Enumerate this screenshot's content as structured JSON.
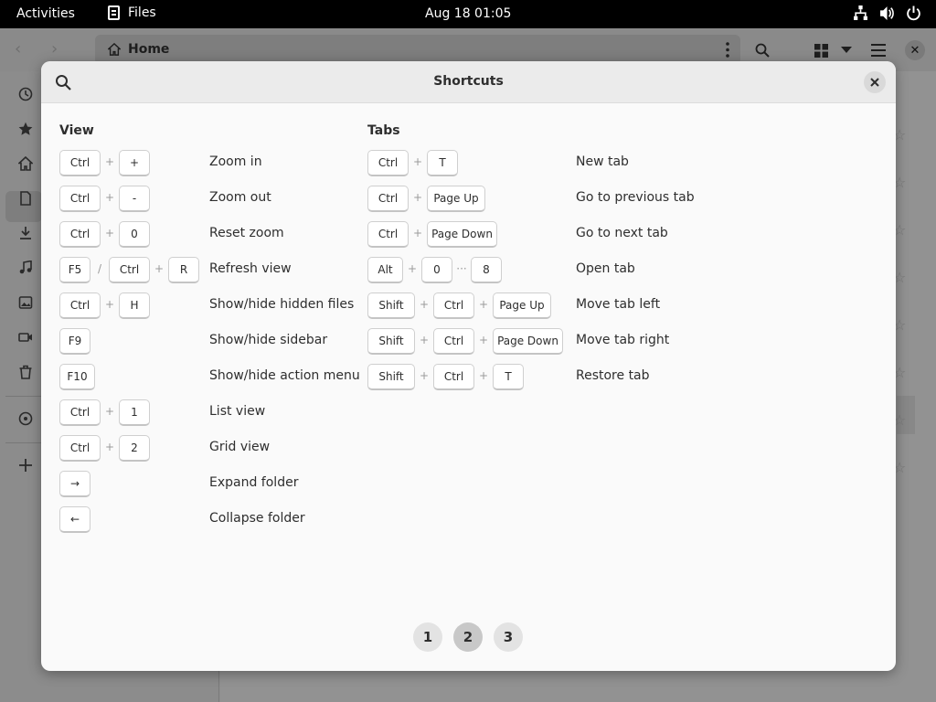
{
  "topbar": {
    "activities": "Activities",
    "app_name": "Files",
    "clock": "Aug 18  01:05"
  },
  "files": {
    "path_label": "Home"
  },
  "dialog": {
    "title": "Shortcuts",
    "sections": [
      {
        "title": "View",
        "rows": [
          {
            "keys": [
              "Ctrl",
              "+",
              "+"
            ],
            "desc": "Zoom in"
          },
          {
            "keys": [
              "Ctrl",
              "+",
              "-"
            ],
            "desc": "Zoom out"
          },
          {
            "keys": [
              "Ctrl",
              "+",
              "0"
            ],
            "desc": "Reset zoom"
          },
          {
            "keys": [
              "F5",
              "/",
              "Ctrl",
              "+",
              "R"
            ],
            "desc": "Refresh view"
          },
          {
            "keys": [
              "Ctrl",
              "+",
              "H"
            ],
            "desc": "Show/hide hidden files"
          },
          {
            "keys": [
              "F9"
            ],
            "desc": "Show/hide sidebar"
          },
          {
            "keys": [
              "F10"
            ],
            "desc": "Show/hide action menu"
          },
          {
            "keys": [
              "Ctrl",
              "+",
              "1"
            ],
            "desc": "List view"
          },
          {
            "keys": [
              "Ctrl",
              "+",
              "2"
            ],
            "desc": "Grid view"
          },
          {
            "keys": [
              "→"
            ],
            "desc": "Expand folder"
          },
          {
            "keys": [
              "←"
            ],
            "desc": "Collapse folder"
          }
        ]
      },
      {
        "title": "Tabs",
        "rows": [
          {
            "keys": [
              "Ctrl",
              "+",
              "T"
            ],
            "desc": "New tab"
          },
          {
            "keys": [
              "Ctrl",
              "+",
              "Page Up"
            ],
            "desc": "Go to previous tab"
          },
          {
            "keys": [
              "Ctrl",
              "+",
              "Page Down"
            ],
            "desc": "Go to next tab"
          },
          {
            "keys": [
              "Alt",
              "+",
              "0",
              "···",
              "8"
            ],
            "desc": "Open tab"
          },
          {
            "keys": [
              "Shift",
              "+",
              "Ctrl",
              "+",
              "Page Up"
            ],
            "desc": "Move tab left"
          },
          {
            "keys": [
              "Shift",
              "+",
              "Ctrl",
              "+",
              "Page Down"
            ],
            "desc": "Move tab right"
          },
          {
            "keys": [
              "Shift",
              "+",
              "Ctrl",
              "+",
              "T"
            ],
            "desc": "Restore tab"
          }
        ]
      }
    ],
    "pages": [
      "1",
      "2",
      "3"
    ],
    "active_page": "2"
  },
  "colors": {
    "dialog_bg": "#fafafa",
    "header_bg": "#ebebeb",
    "text": "#2e2e2e"
  }
}
